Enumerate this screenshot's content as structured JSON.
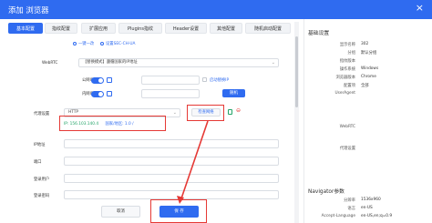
{
  "window": {
    "title": "添加 浏览器",
    "close_icon": "×"
  },
  "tabs": [
    "基本配置",
    "指纹配置",
    "扩展应用",
    "Plugins指纹",
    "Header设置",
    "其他配置",
    "随机启动配置"
  ],
  "subtabs": {
    "one_click": "一键一改",
    "sec_ch_ua": "设置SEC-CH-UA"
  },
  "form": {
    "webrtc_label": "WebRTC",
    "webrtc_value": "【替换模式】遵循国家的IP地址",
    "public_ip_label": "公网IP：",
    "enable_proxy_label": "启动替换IP",
    "intranet_ip_label": "内网IP：",
    "random_button": "随机",
    "proxy_label": "代理设置",
    "proxy_type": "HTTP",
    "detect_button": "检查网络",
    "proxy_ip": "IP: 156.103.140.4",
    "proxy_location": "国家/地区: 1.0 /",
    "ip_address_label": "IP地址",
    "port_label": "端口",
    "login_user_label": "登录用户",
    "login_password_label": "登录密码"
  },
  "buttons": {
    "cancel": "取消",
    "save": "保 存"
  },
  "right_panel": {
    "basic_header": "基础设置",
    "rows": [
      {
        "k": "显示名称",
        "v": "302"
      },
      {
        "k": "分组",
        "v": "默认分组"
      },
      {
        "k": "指纹版本",
        "v": ""
      },
      {
        "k": "操作系统",
        "v": "Windows"
      },
      {
        "k": "浏览器版本",
        "v": "Chrome"
      },
      {
        "k": "配置项",
        "v": "全部"
      },
      {
        "k": "UserAgent",
        "v": ""
      }
    ],
    "webrtc_k": "WebRTC",
    "proxy_k": "代理设置",
    "navigator_header": "Navigator参数",
    "nav_rows": [
      {
        "k": "分辨率",
        "v": "1536x960"
      },
      {
        "k": "语言",
        "v": "en-US"
      },
      {
        "k": "Accept-Language",
        "v": "en-US,en;q=0.9"
      }
    ]
  },
  "colors": {
    "brand": "#2f6bf0",
    "highlight": "#e53935",
    "success": "#21a366"
  }
}
